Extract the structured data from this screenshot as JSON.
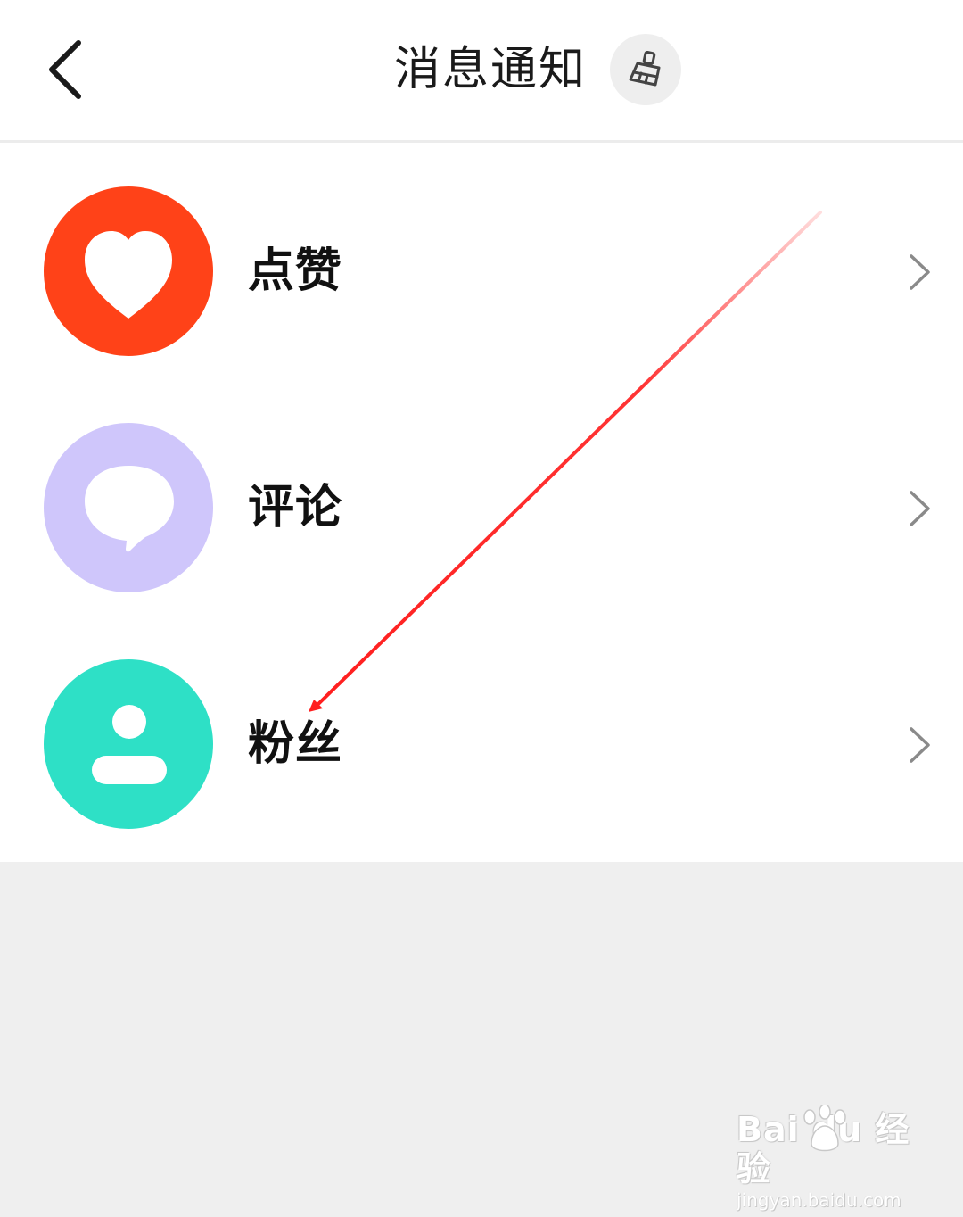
{
  "header": {
    "title": "消息通知",
    "back_icon": "chevron-left-icon",
    "clear_icon": "broom-icon"
  },
  "notifications": [
    {
      "label": "点赞",
      "icon": "heart-icon",
      "color": "#ff4218"
    },
    {
      "label": "评论",
      "icon": "speech-bubble-icon",
      "color": "#cfc6fb"
    },
    {
      "label": "粉丝",
      "icon": "person-icon",
      "color": "#2ee0c6"
    }
  ],
  "colors": {
    "header_bg": "#ffffff",
    "page_bg": "#efefef",
    "annotation_arrow": "#ff1e1e"
  },
  "watermark": {
    "brand": "Bai du 经验",
    "url": "jingyan.baidu.com"
  }
}
